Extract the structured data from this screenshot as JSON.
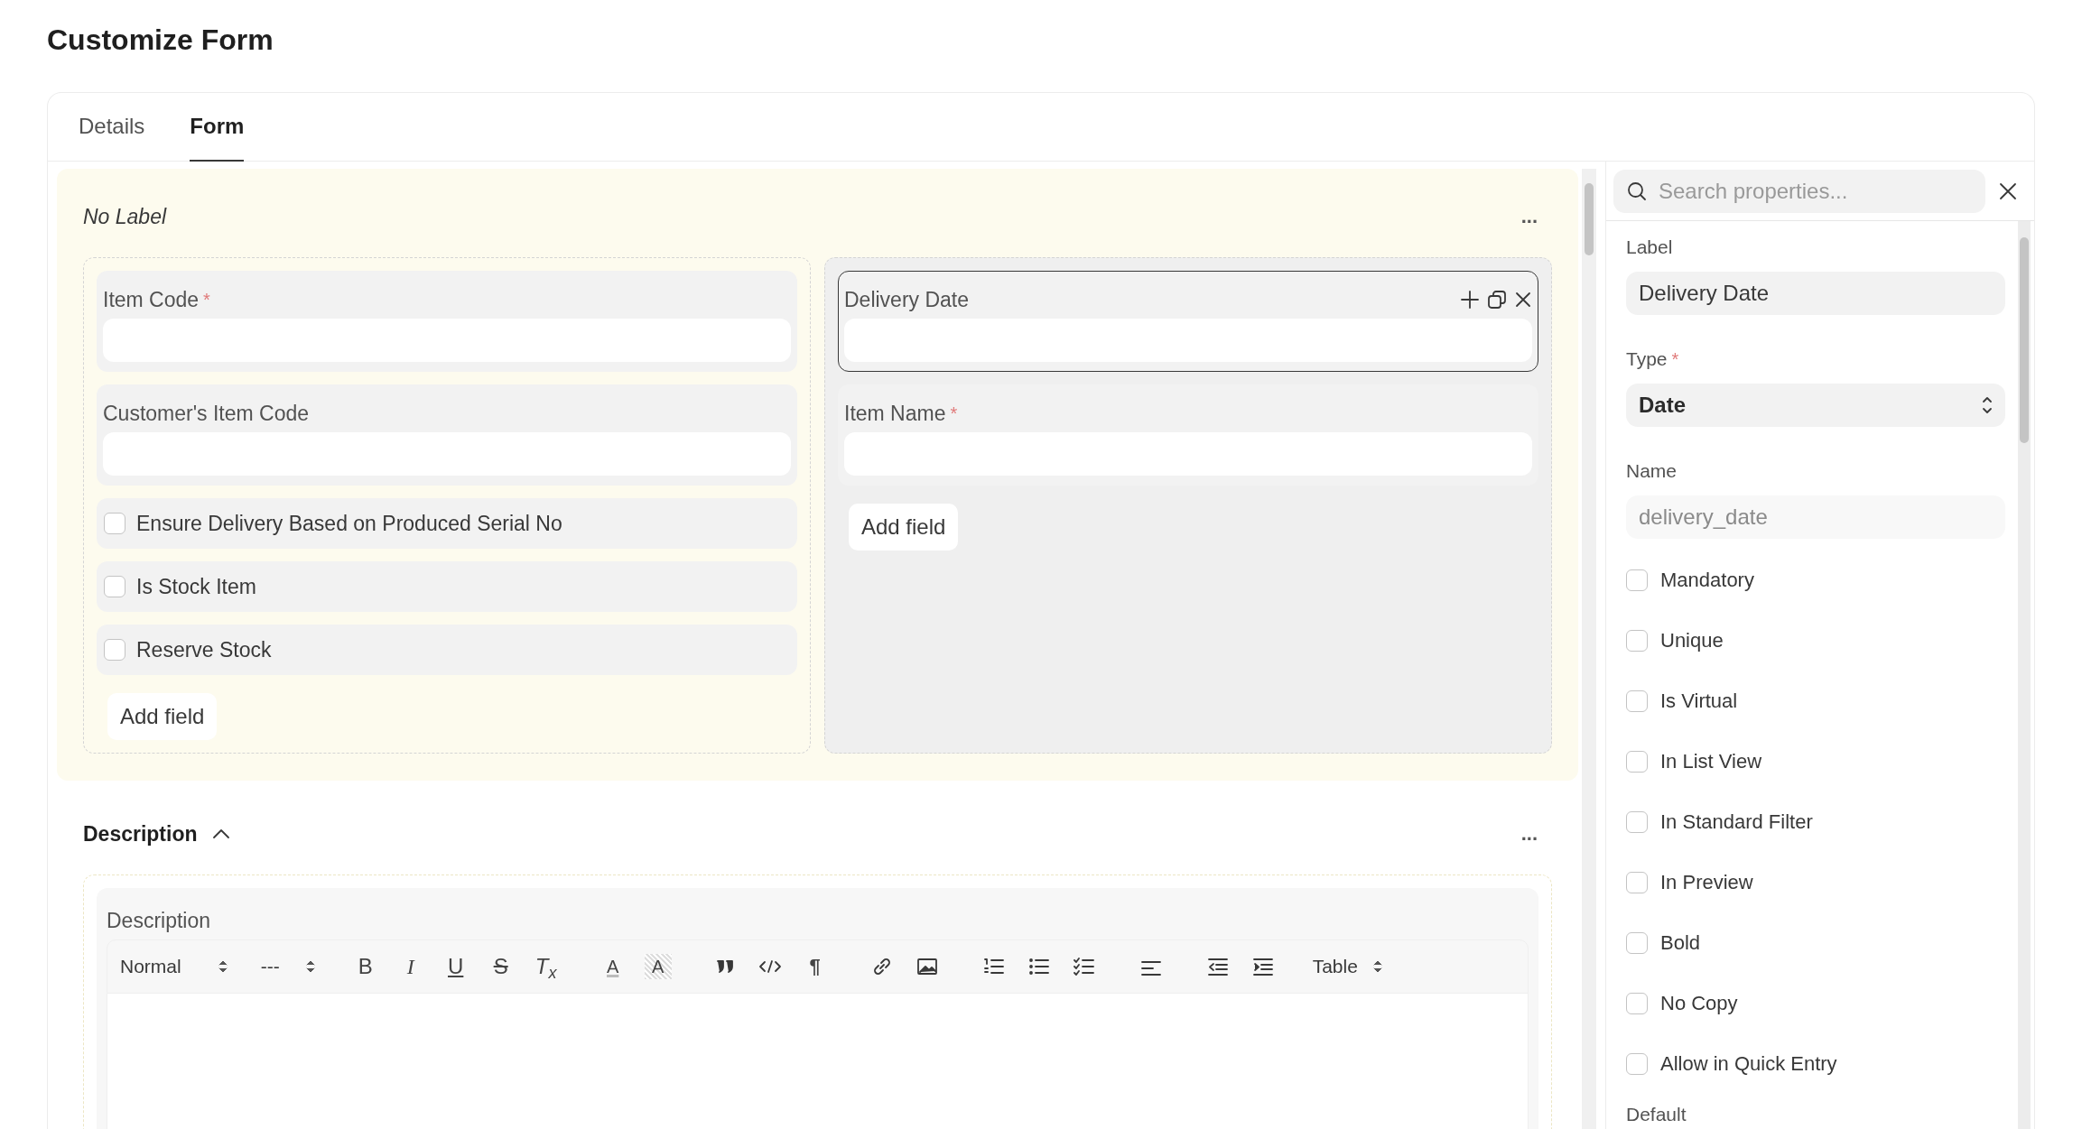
{
  "page_title": "Customize Form",
  "tabs": [
    {
      "label": "Details",
      "selected": false
    },
    {
      "label": "Form",
      "selected": true
    }
  ],
  "sections": [
    {
      "label": "No Label",
      "kind": "unlabeled",
      "selected": true,
      "more": "...",
      "columns": [
        {
          "highlighted": false,
          "add_field": "Add field",
          "fields": [
            {
              "kind": "data",
              "label": "Item Code",
              "required_mark": "*",
              "selected": false
            },
            {
              "kind": "data",
              "label": "Customer's Item Code",
              "selected": false
            },
            {
              "kind": "check",
              "label": "Ensure Delivery Based on Produced Serial No",
              "checked": false
            },
            {
              "kind": "check",
              "label": "Is Stock Item",
              "checked": false
            },
            {
              "kind": "check",
              "label": "Reserve Stock",
              "checked": false
            }
          ]
        },
        {
          "highlighted": true,
          "add_field": "Add field",
          "fields": [
            {
              "kind": "data",
              "label": "Delivery Date",
              "selected": true
            },
            {
              "kind": "data",
              "label": "Item Name",
              "required_mark": "*",
              "selected": false
            }
          ]
        }
      ]
    },
    {
      "label": "Description",
      "kind": "labeled",
      "selected": false,
      "expanded": true,
      "more": "...",
      "columns": [
        {
          "fields": [
            {
              "kind": "editor",
              "label": "Description",
              "toolbar": {
                "header": "Normal",
                "size": "---",
                "bold": "B",
                "italic": "I",
                "underline": "U",
                "strike": "S",
                "clean": "T$_{x}$",
                "fore_glyph": "A",
                "back_glyph": "A",
                "direction": "¶",
                "table": "Table"
              }
            }
          ]
        }
      ]
    }
  ],
  "properties": {
    "search": {
      "placeholder": "Search properties..."
    },
    "items": [
      {
        "kind": "input",
        "label": "Label",
        "value": "Delivery Date"
      },
      {
        "kind": "select",
        "label": "Type",
        "required_mark": "*",
        "value": "Date"
      },
      {
        "kind": "readonly",
        "label": "Name",
        "value": "delivery_date"
      },
      {
        "kind": "check",
        "label": "Mandatory",
        "checked": false
      },
      {
        "kind": "check",
        "label": "Unique",
        "checked": false
      },
      {
        "kind": "check",
        "label": "Is Virtual",
        "checked": false
      },
      {
        "kind": "check",
        "label": "In List View",
        "checked": false
      },
      {
        "kind": "check",
        "label": "In Standard Filter",
        "checked": false
      },
      {
        "kind": "check",
        "label": "In Preview",
        "checked": false
      },
      {
        "kind": "check",
        "label": "Bold",
        "checked": false
      },
      {
        "kind": "check",
        "label": "No Copy",
        "checked": false
      },
      {
        "kind": "check",
        "label": "Allow in Quick Entry",
        "checked": false
      },
      {
        "kind": "heading",
        "label": "Default"
      }
    ]
  }
}
